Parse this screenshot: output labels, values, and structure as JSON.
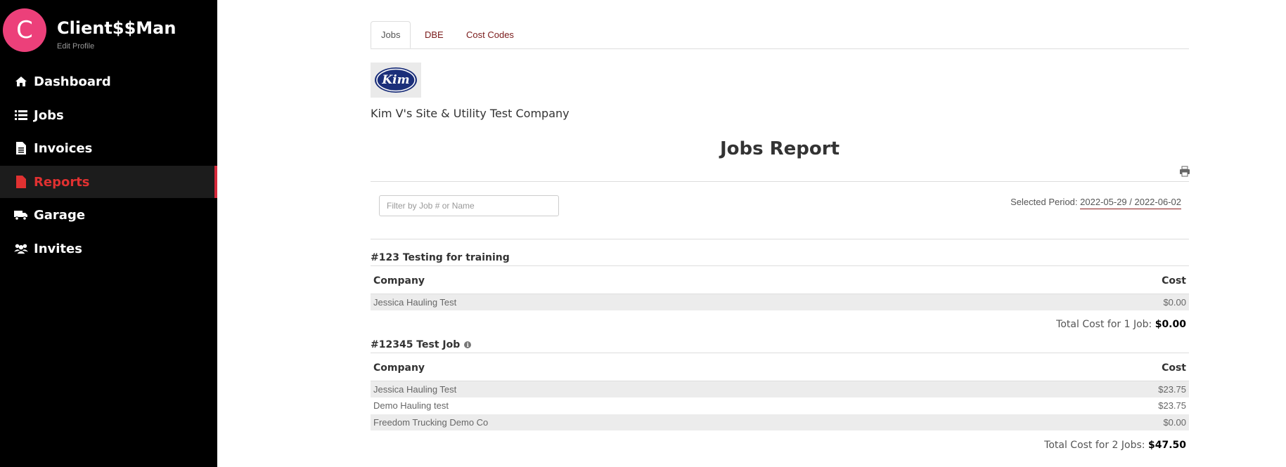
{
  "user": {
    "avatar_letter": "C",
    "name": "Client$$Man",
    "edit_profile": "Edit Profile"
  },
  "sidebar": {
    "items": [
      {
        "label": "Dashboard",
        "icon": "home-icon"
      },
      {
        "label": "Jobs",
        "icon": "list-icon"
      },
      {
        "label": "Invoices",
        "icon": "document-icon"
      },
      {
        "label": "Reports",
        "icon": "file-icon",
        "active": true
      },
      {
        "label": "Garage",
        "icon": "truck-icon"
      },
      {
        "label": "Invites",
        "icon": "users-icon"
      }
    ]
  },
  "tabs": [
    {
      "label": "Jobs",
      "active": true
    },
    {
      "label": "DBE"
    },
    {
      "label": "Cost Codes"
    }
  ],
  "company": {
    "logo_text": "Kim",
    "name": "Kim V's Site & Utility Test Company"
  },
  "report": {
    "title": "Jobs Report",
    "filter_placeholder": "Filter by Job # or Name",
    "period_label": "Selected Period:",
    "period_value": "2022-05-29 / 2022-06-02"
  },
  "jobs": [
    {
      "title": "#123 Testing for training",
      "col_company": "Company",
      "col_cost": "Cost",
      "rows": [
        {
          "company": "Jessica Hauling Test",
          "cost": "$0.00"
        }
      ],
      "total_label": "Total Cost for 1 Job:",
      "total_value": "$0.00"
    },
    {
      "title": "#12345 Test Job",
      "col_company": "Company",
      "col_cost": "Cost",
      "rows": [
        {
          "company": "Jessica Hauling Test",
          "cost": "$23.75"
        },
        {
          "company": "Demo Hauling test",
          "cost": "$23.75"
        },
        {
          "company": "Freedom Trucking Demo Co",
          "cost": "$0.00"
        }
      ],
      "total_label": "Total Cost for 2 Jobs:",
      "total_value": "$47.50"
    }
  ],
  "colors": {
    "sidebar_bg": "#000000",
    "avatar": "#ec407a",
    "active_nav": "#e03131",
    "tab_link": "#7a1a1a"
  }
}
